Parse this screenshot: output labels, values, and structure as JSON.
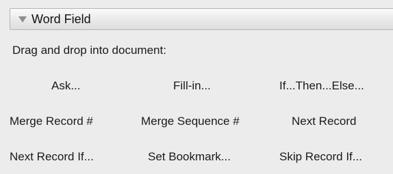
{
  "section": {
    "title": "Word Field",
    "expanded": true
  },
  "instructions": "Drag and drop into document:",
  "fields": [
    [
      "Ask...",
      "Fill-in...",
      "If...Then...Else..."
    ],
    [
      "Merge Record #",
      "Merge Sequence #",
      "Next Record"
    ],
    [
      "Next Record If...",
      "Set Bookmark...",
      "Skip Record If..."
    ]
  ]
}
